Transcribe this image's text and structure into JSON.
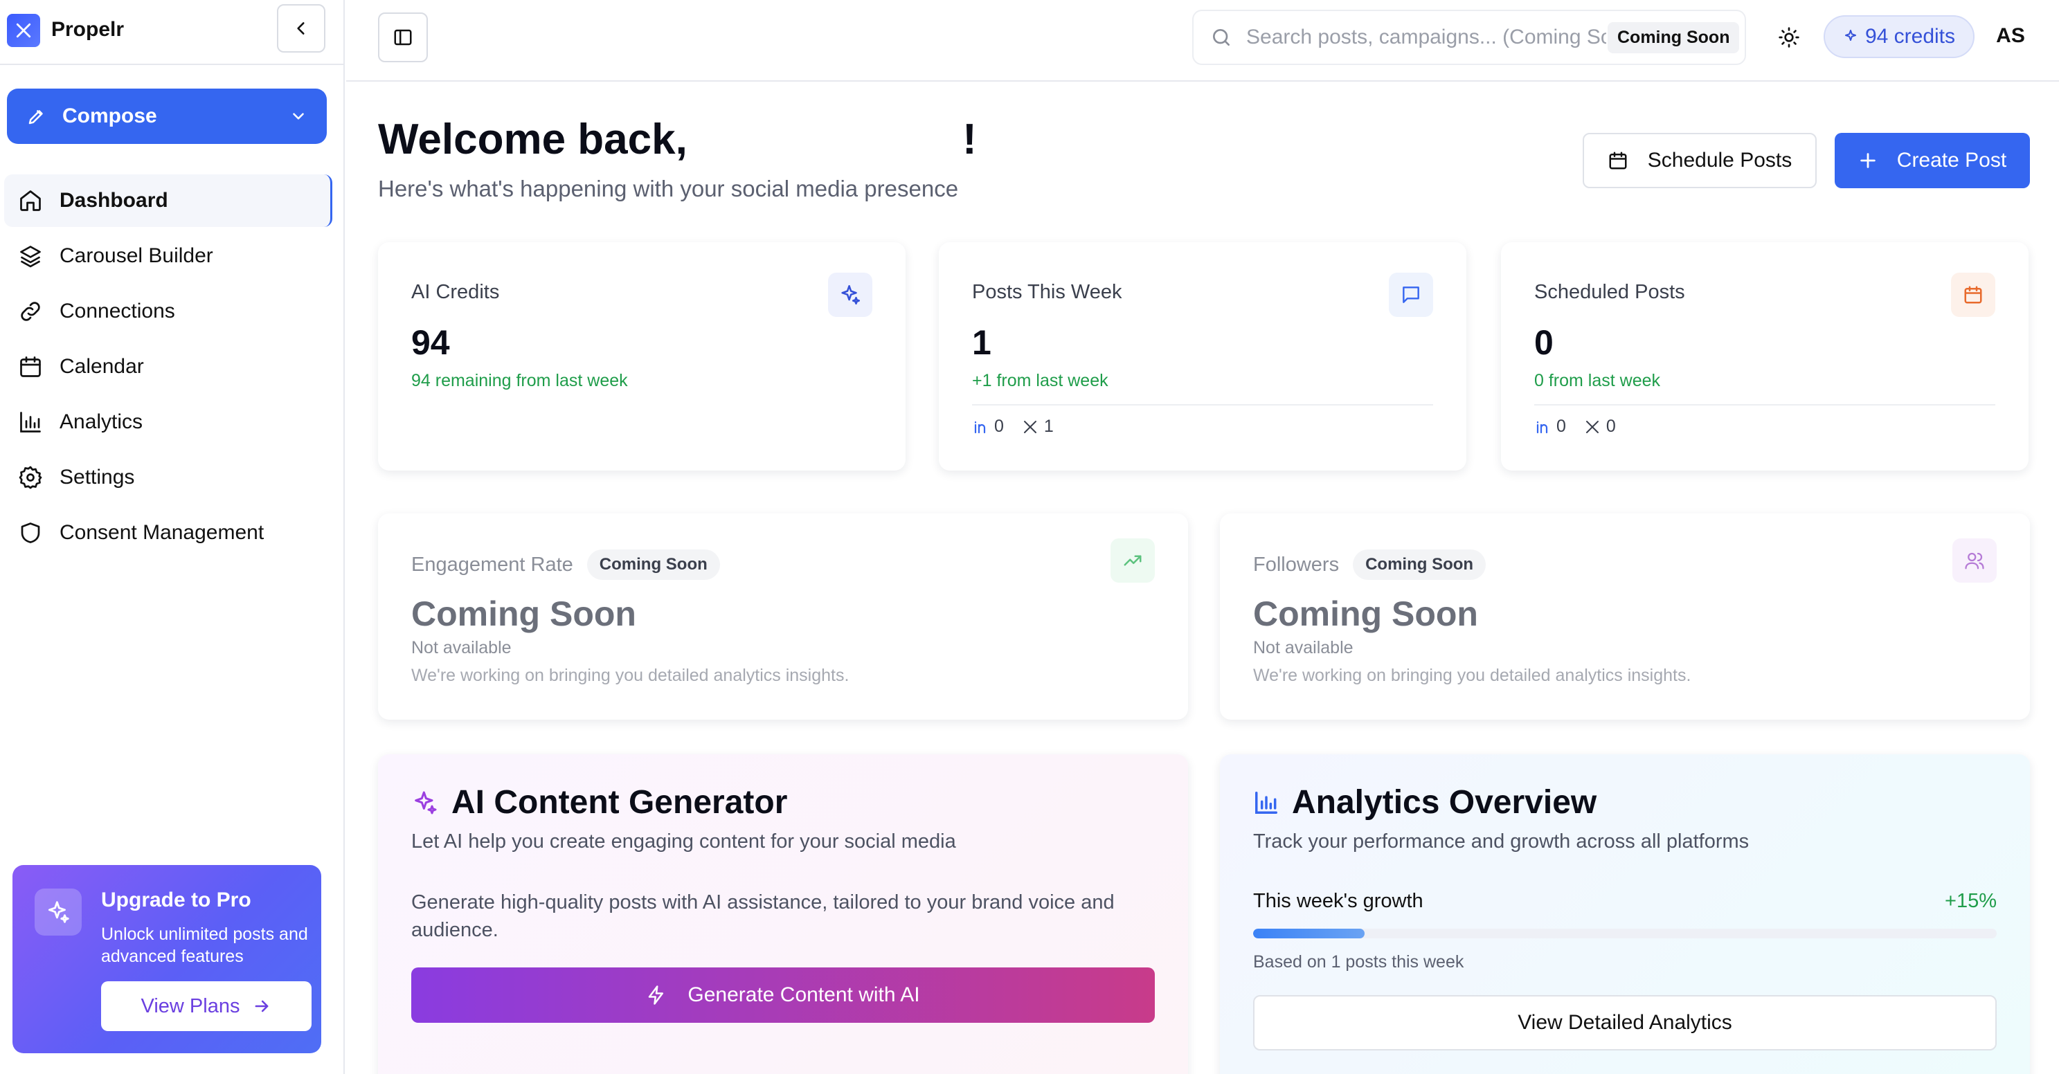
{
  "app": {
    "name": "Propelr"
  },
  "sidebar": {
    "compose_label": "Compose",
    "items": [
      {
        "label": "Dashboard",
        "icon": "home-icon",
        "active": true
      },
      {
        "label": "Carousel Builder",
        "icon": "layers-icon"
      },
      {
        "label": "Connections",
        "icon": "link-icon"
      },
      {
        "label": "Calendar",
        "icon": "calendar-icon"
      },
      {
        "label": "Analytics",
        "icon": "bar-chart-icon"
      },
      {
        "label": "Settings",
        "icon": "gear-icon"
      },
      {
        "label": "Consent Management",
        "icon": "shield-icon"
      }
    ],
    "upgrade": {
      "title": "Upgrade to Pro",
      "text": "Unlock unlimited posts and advanced features",
      "button": "View Plans"
    }
  },
  "topbar": {
    "search_placeholder": "Search posts, campaigns... (Coming Soon)",
    "search_badge": "Coming Soon",
    "credits_label": "94 credits",
    "avatar_initials": "AS"
  },
  "main": {
    "welcome_prefix": "Welcome back,",
    "welcome_suffix": "!",
    "subtitle": "Here's what's happening with your social media presence",
    "schedule_label": "Schedule Posts",
    "create_label": "Create Post",
    "stats": [
      {
        "label": "AI Credits",
        "value": "94",
        "sub": "94 remaining from last week",
        "icon": "sparkle-icon"
      },
      {
        "label": "Posts This Week",
        "value": "1",
        "sub": "+1 from last week",
        "icon": "message-icon",
        "linkedin": "0",
        "x": "1"
      },
      {
        "label": "Scheduled Posts",
        "value": "0",
        "sub": "0 from last week",
        "icon": "calendar-icon",
        "linkedin": "0",
        "x": "0"
      }
    ],
    "engagement": {
      "label": "Engagement Rate",
      "badge": "Coming Soon",
      "value": "Coming Soon",
      "sub": "Not available",
      "note": "We're working on bringing you detailed analytics insights."
    },
    "followers": {
      "label": "Followers",
      "badge": "Coming Soon",
      "value": "Coming Soon",
      "sub": "Not available",
      "note": "We're working on bringing you detailed analytics insights."
    },
    "ai_generator": {
      "title": "AI Content Generator",
      "desc": "Let AI help you create engaging content for your social media",
      "body": "Generate high-quality posts with AI assistance, tailored to your brand voice and audience.",
      "button": "Generate Content with AI"
    },
    "analytics": {
      "title": "Analytics Overview",
      "desc": "Track your performance and growth across all platforms",
      "growth_label": "This week's growth",
      "growth_value": "+15%",
      "growth_percent": 15,
      "note": "Based on 1 posts this week",
      "button": "View Detailed Analytics"
    }
  },
  "colors": {
    "accent": "#3566f0",
    "success": "#1f9d4a",
    "gradient_start": "#8a3ce0",
    "gradient_end": "#c83b8a"
  }
}
